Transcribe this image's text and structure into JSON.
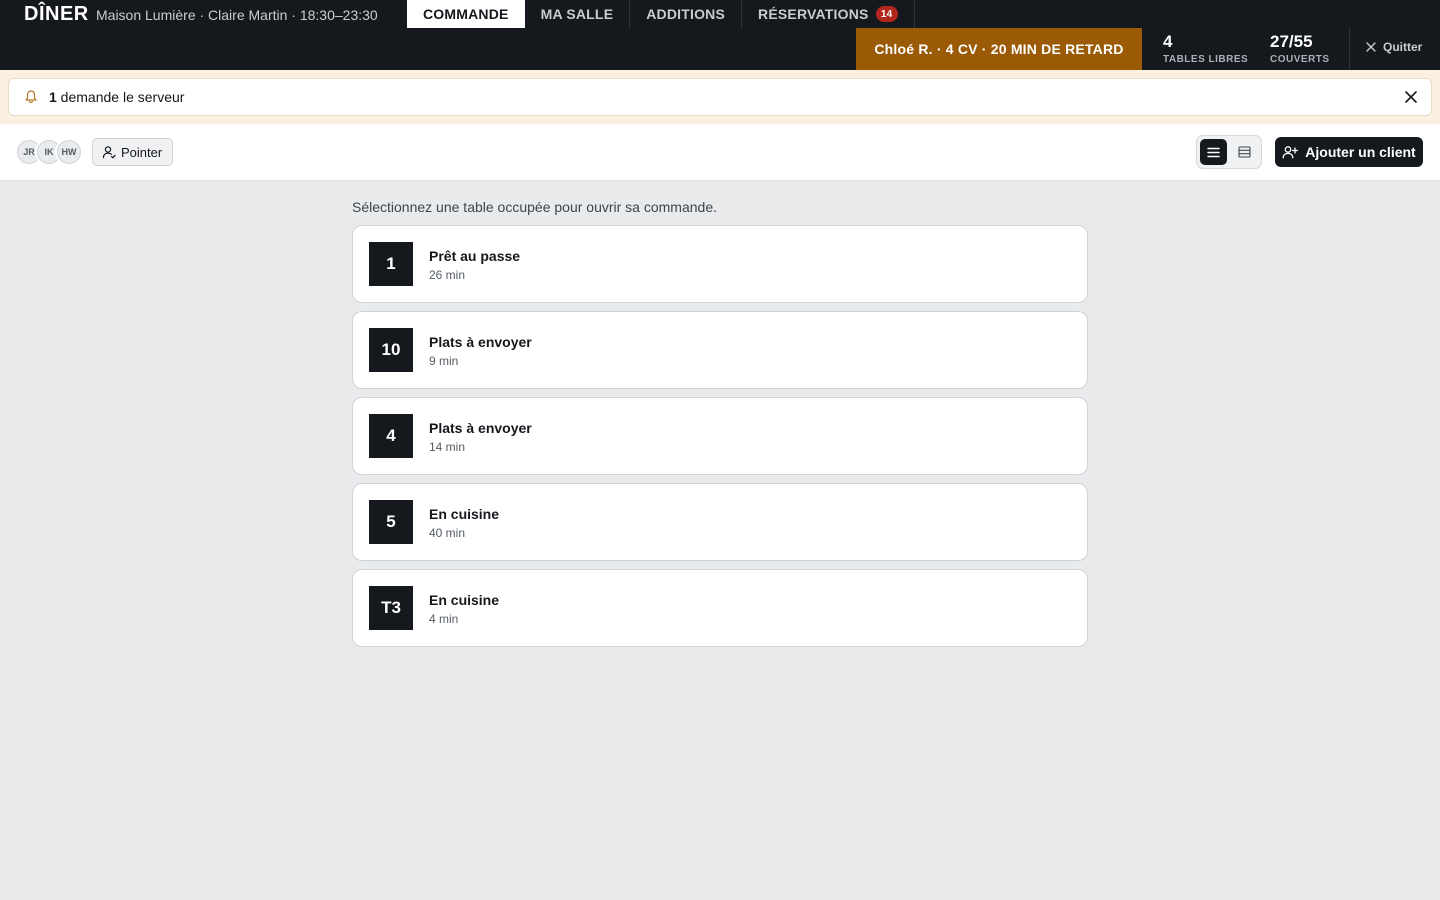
{
  "header": {
    "brand": "DÎNER",
    "subtitle": "Maison Lumière · Claire Martin · 18:30–23:30",
    "tabs": [
      {
        "label": "COMMANDE",
        "active": true
      },
      {
        "label": "MA SALLE",
        "active": false
      },
      {
        "label": "ADDITIONS",
        "active": false
      },
      {
        "label": "RÉSERVATIONS",
        "active": false,
        "badge": "14"
      }
    ],
    "late_alert": "Chloé R. · 4 CV · 20 MIN DE RETARD",
    "stats": {
      "tables_value": "4",
      "tables_label": "TABLES LIBRES",
      "covers_value": "27/55",
      "covers_label": "COUVERTS"
    },
    "quit_label": "Quitter"
  },
  "notice": {
    "count": "1",
    "text": " demande le serveur"
  },
  "toolbar": {
    "avatars": [
      "JR",
      "IK",
      "HW"
    ],
    "pointer_label": "Pointer",
    "add_client_label": "Ajouter un client"
  },
  "main": {
    "instruction": "Sélectionnez une table occupée pour ouvrir sa commande.",
    "orders": [
      {
        "table": "1",
        "status": "Prêt au passe",
        "time": "26 min"
      },
      {
        "table": "10",
        "status": "Plats à envoyer",
        "time": "9 min"
      },
      {
        "table": "4",
        "status": "Plats à envoyer",
        "time": "14 min"
      },
      {
        "table": "5",
        "status": "En cuisine",
        "time": "40 min"
      },
      {
        "table": "T3",
        "status": "En cuisine",
        "time": "4 min"
      }
    ]
  },
  "colors": {
    "dark": "#15181c",
    "late_alert": "#9a5a06",
    "badge": "#b3261e",
    "notice_band": "#fbefe0"
  },
  "icons": {
    "notice": "bell-icon",
    "notice_close": "close-icon",
    "quit": "close-icon",
    "pointer": "user-icon",
    "view_list": "list-view-icon",
    "view_compact": "compact-view-icon",
    "add_client": "user-plus-icon"
  }
}
